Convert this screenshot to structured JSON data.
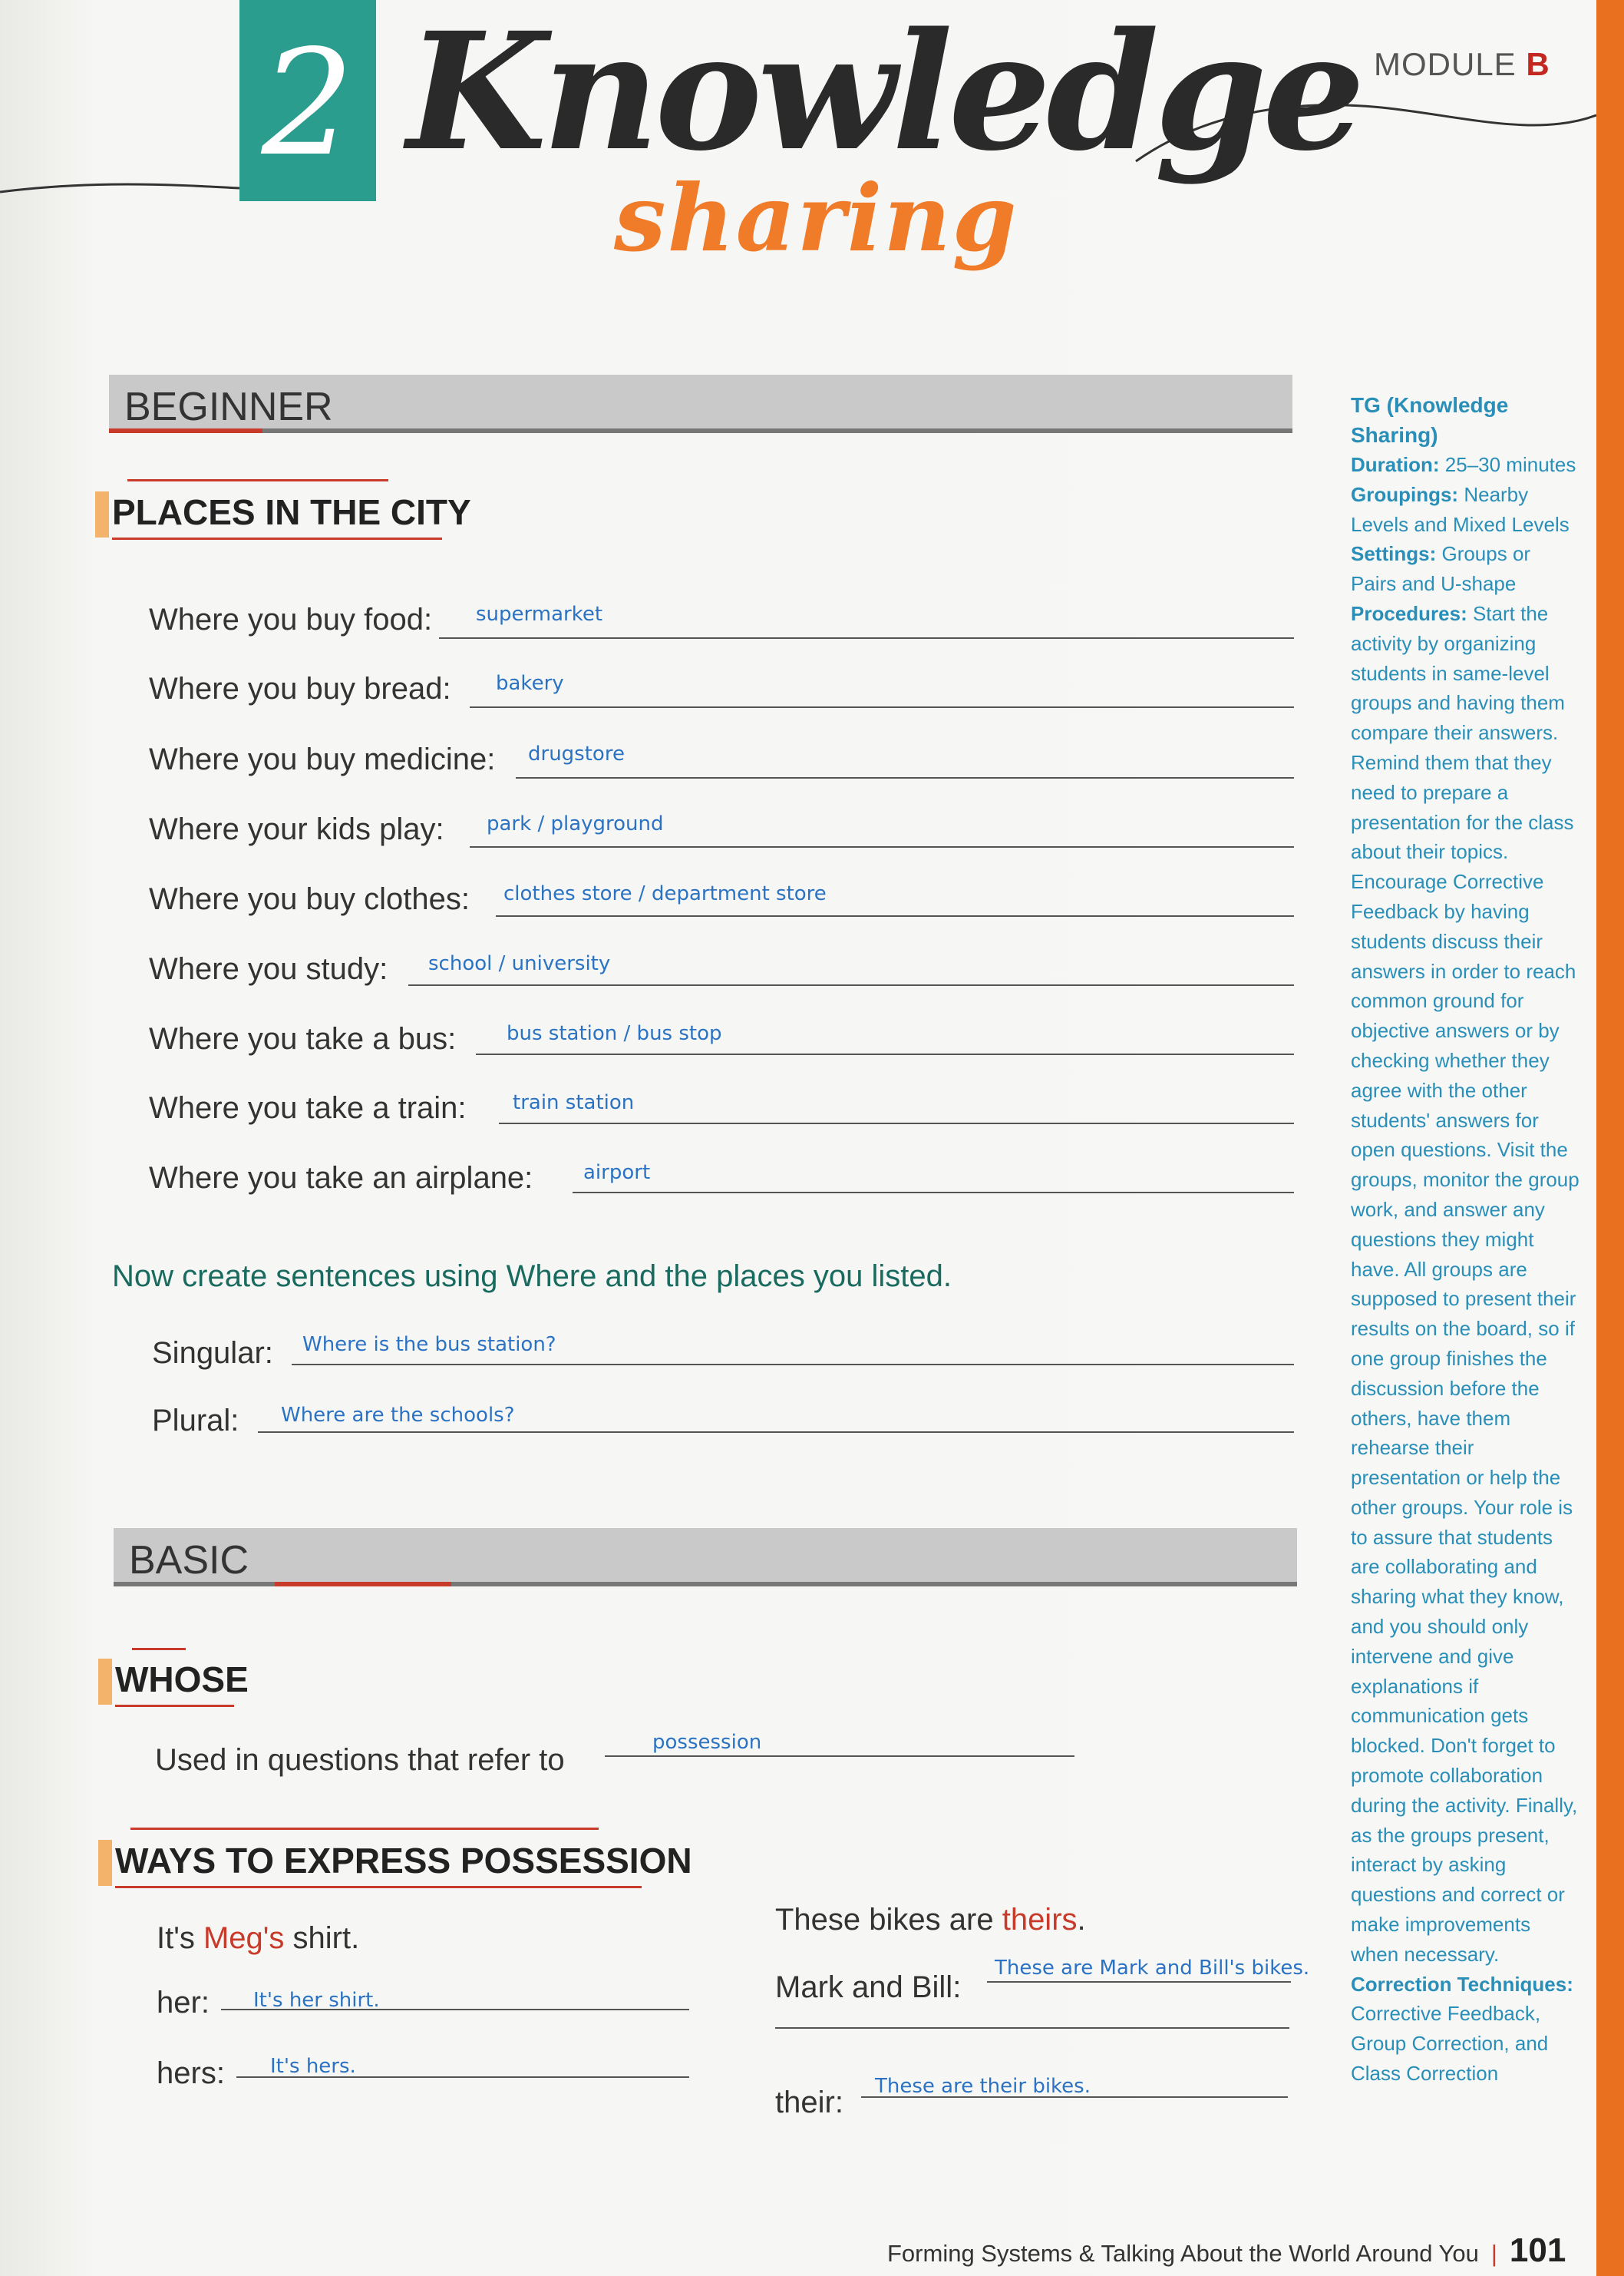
{
  "header": {
    "number": "2",
    "title_main": "Knowledge",
    "title_sub": "sharing",
    "module_label": "MODULE",
    "module_letter": "B"
  },
  "beginner": {
    "level": "BEGINNER",
    "section": "PLACES IN THE CITY",
    "items": [
      {
        "prompt": "Where you buy food:",
        "answer": "supermarket"
      },
      {
        "prompt": "Where you buy bread:",
        "answer": "bakery"
      },
      {
        "prompt": "Where you buy medicine:",
        "answer": "drugstore"
      },
      {
        "prompt": "Where your kids play:",
        "answer": "park / playground"
      },
      {
        "prompt": "Where you buy clothes:",
        "answer": "clothes store / department store"
      },
      {
        "prompt": "Where you study:",
        "answer": "school / university"
      },
      {
        "prompt": "Where you take a bus:",
        "answer": "bus station / bus stop"
      },
      {
        "prompt": "Where you take a train:",
        "answer": "train station"
      },
      {
        "prompt": "Where you take an airplane:",
        "answer": "airport"
      }
    ],
    "instruction": "Now create sentences using Where and the places you listed.",
    "singular_label": "Singular:",
    "singular_answer": "Where is the bus station?",
    "plural_label": "Plural:",
    "plural_answer": "Where are the schools?"
  },
  "basic": {
    "level": "BASIC",
    "whose_title": "WHOSE",
    "whose_text": "Used in questions that refer to",
    "whose_answer": "possession",
    "ways_title": "WAYS TO EXPRESS POSSESSION",
    "example_left_pre": "It's ",
    "example_left_red": "Meg's",
    "example_left_post": " shirt.",
    "her_label": "her:",
    "her_answer": "It's her shirt.",
    "hers_label": "hers:",
    "hers_answer": "It's hers.",
    "example_right_pre": "These bikes are ",
    "example_right_red": "theirs",
    "example_right_post": ".",
    "mark_label": "Mark and Bill:",
    "mark_answer": "These are Mark and Bill's bikes.",
    "their_label": "their:",
    "their_answer": "These are their bikes."
  },
  "sidebar": {
    "tg_title": "TG (Knowledge Sharing)",
    "duration_label": "Duration:",
    "duration_value": "25–30 minutes",
    "groupings_label": "Groupings:",
    "groupings_value": "Nearby Levels and Mixed Levels",
    "settings_label": "Settings:",
    "settings_value": "Groups or Pairs and U-shape",
    "procedures_label": "Procedures:",
    "procedures_value": "Start the activity by organizing students in same-level groups and having them compare their answers. Remind them that they need to prepare a presentation for the class about their topics. Encourage Corrective Feedback by having students discuss their answers in order to reach common ground for objective answers or by checking whether they agree with the other students' answers for open questions. Visit the groups, monitor the group work, and answer any questions they might have. All groups are supposed to present their results on the board, so if one group finishes the discussion before the others, have them rehearse their presentation or help the other groups. Your role is to assure that students are collaborating and sharing what they know, and you should only intervene and give explanations if communication gets blocked. Don't forget to promote collaboration during the activity. Finally, as the groups present, interact by asking questions and correct or make improvements when necessary.",
    "techniques_label": "Correction Techniques:",
    "techniques_value": "Corrective Feedback, Group Correction, and Class Correction"
  },
  "footer": {
    "text": "Forming Systems & Talking About the World Around You",
    "separator": "|",
    "page": "101"
  }
}
